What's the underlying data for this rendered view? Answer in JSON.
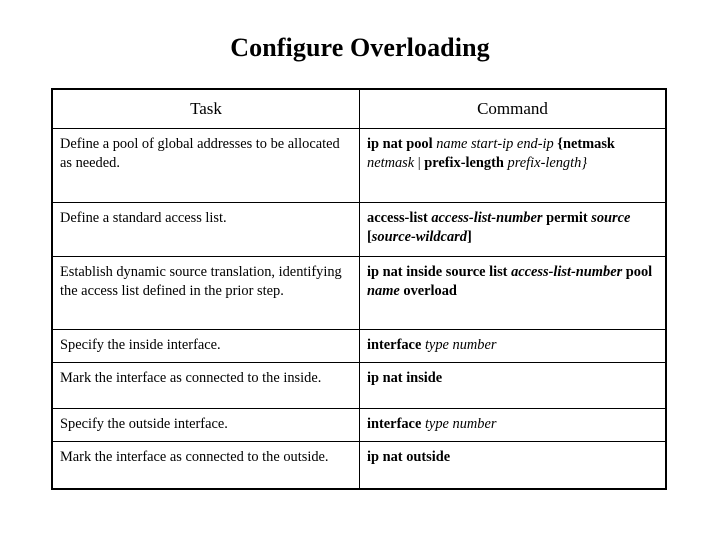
{
  "slide": {
    "title": "Configure Overloading",
    "background_color": "#ffffff",
    "text_color": "#000000",
    "border_color": "#000000"
  },
  "table": {
    "headers": {
      "task": "Task",
      "command": "Command"
    },
    "rows": [
      {
        "task": "Define a pool of global addresses to be allocated as needed.",
        "command_plain": "ip nat pool name start-ip end-ip {netmask netmask | prefix-length prefix-length}",
        "command_parts": [
          {
            "text": "ip nat pool ",
            "style": "bold"
          },
          {
            "text": "name start-ip end-ip ",
            "style": "italic"
          },
          {
            "text": "{netmask ",
            "style": "bold"
          },
          {
            "text": "netmask ",
            "style": "italic"
          },
          {
            "text": "| ",
            "style": "normal"
          },
          {
            "text": "prefix-length ",
            "style": "bold"
          },
          {
            "text": "prefix-length}",
            "style": "italic"
          }
        ]
      },
      {
        "task": "Define a standard access list.",
        "command_plain": "access-list access-list-number permit source [source-wildcard]",
        "command_parts": [
          {
            "text": "access-list ",
            "style": "bold"
          },
          {
            "text": "access-list-number",
            "style": "bold-italic"
          },
          {
            "text": " permit ",
            "style": "bold"
          },
          {
            "text": "source",
            "style": "bold-italic"
          },
          {
            "text": " [",
            "style": "bold"
          },
          {
            "text": "source-wildcard",
            "style": "bold-italic"
          },
          {
            "text": "]",
            "style": "bold"
          }
        ]
      },
      {
        "task": "Establish dynamic source translation, identifying the access list defined in the prior step.",
        "command_plain": "ip nat inside source list access-list-number pool name overload",
        "command_parts": [
          {
            "text": "ip nat inside source list ",
            "style": "bold"
          },
          {
            "text": "access-list-number",
            "style": "bold-italic"
          },
          {
            "text": " pool ",
            "style": "bold"
          },
          {
            "text": "name",
            "style": "bold-italic"
          },
          {
            "text": " overload",
            "style": "bold"
          }
        ]
      },
      {
        "task": "Specify the inside interface.",
        "command_plain": "interface type number",
        "command_parts": [
          {
            "text": "interface ",
            "style": "bold"
          },
          {
            "text": "type number",
            "style": "italic"
          }
        ]
      },
      {
        "task": "Mark the interface as connected to the inside.",
        "command_plain": "ip nat inside",
        "command_parts": [
          {
            "text": "ip nat inside",
            "style": "bold"
          }
        ]
      },
      {
        "task": "Specify the outside interface.",
        "command_plain": "interface type number",
        "command_parts": [
          {
            "text": "interface ",
            "style": "bold"
          },
          {
            "text": "type number",
            "style": "italic"
          }
        ]
      },
      {
        "task": "Mark the interface as connected to the outside.",
        "command_plain": "ip nat outside",
        "command_parts": [
          {
            "text": "ip nat outside",
            "style": "bold"
          }
        ]
      }
    ]
  }
}
